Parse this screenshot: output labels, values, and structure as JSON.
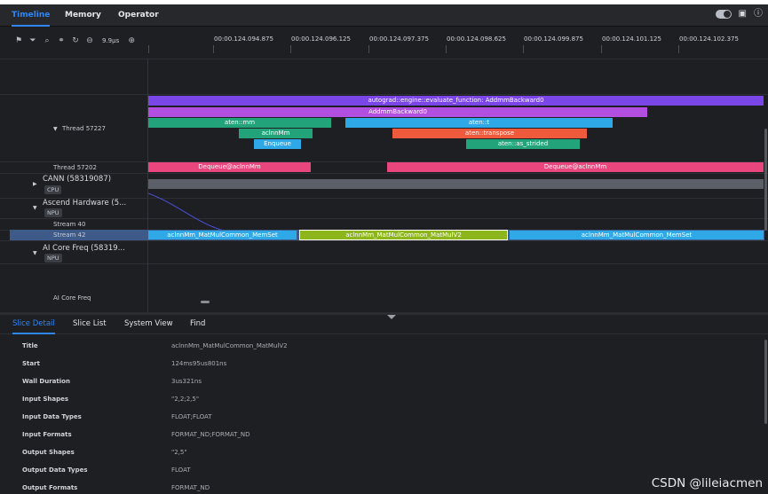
{
  "header": {
    "tabs": [
      {
        "label": "Timeline",
        "active": true
      },
      {
        "label": "Memory",
        "active": false
      },
      {
        "label": "Operator",
        "active": false
      }
    ],
    "icons": [
      "theme-toggle-icon",
      "save-icon",
      "help-icon"
    ]
  },
  "toolbar": {
    "icons": [
      "flag-icon",
      "filter-icon",
      "search-icon",
      "link-icon",
      "reset-icon",
      "zoom-out-icon",
      "zoom-in-icon"
    ],
    "zoom_level": "9.9μs"
  },
  "ruler": {
    "ticks": [
      "00:00.124.094.875",
      "00:00.124.096.125",
      "00:00.124.097.375",
      "00:00.124.098.625",
      "00:00.124.099.875",
      "00:00.124.101.125",
      "00:00.124.102.375"
    ]
  },
  "tracks": {
    "thread1": {
      "label": "Thread 57227"
    },
    "thread2": {
      "label": "Thread 57202"
    },
    "cann": {
      "label": "CANN (58319087)",
      "badge": "CPU"
    },
    "ascend": {
      "label": "Ascend Hardware (5...",
      "badge": "NPU"
    },
    "stream40": {
      "label": "Stream 40"
    },
    "stream42": {
      "label": "Stream 42"
    },
    "aicore": {
      "label": "AI Core Freq (58319...",
      "badge": "NPU"
    },
    "aicore_freq": {
      "label": "AI Core Freq"
    }
  },
  "slices": {
    "evaluate": "autograd::engine::evaluate_function: AddmmBackward0",
    "addmm": "AddmmBackward0",
    "mm": "aten::mm",
    "t": "aten::t",
    "aclnnmm": "aclnnMm",
    "transpose": "aten::transpose",
    "enqueue": "Enqueue",
    "as_strided": "aten::as_strided",
    "dequeue1": "Dequeue@aclnnMm",
    "dequeue2": "Dequeue@aclnnMm",
    "memset1": "aclnnMm_MatMulCommon_MemSet",
    "matmul": "aclnnMm_MatMulCommon_MatMulV2",
    "memset2": "aclnnMm_MatMulCommon_MemSet"
  },
  "colors": {
    "purple": "#7b46e8",
    "violet": "#b24ee0",
    "green": "#22a37a",
    "blue": "#2ea8e6",
    "orange_red": "#f05a3c",
    "pink": "#e8467c",
    "olive": "#8db51c",
    "accent": "#2f86f5"
  },
  "detail_panel": {
    "tabs": [
      {
        "label": "Slice Detail",
        "active": true
      },
      {
        "label": "Slice List",
        "active": false
      },
      {
        "label": "System View",
        "active": false
      },
      {
        "label": "Find",
        "active": false
      }
    ],
    "rows": [
      {
        "key": "Title",
        "value": "aclnnMm_MatMulCommon_MatMulV2"
      },
      {
        "key": "Start",
        "value": "124ms95us801ns"
      },
      {
        "key": "Wall Duration",
        "value": "3us321ns"
      },
      {
        "key": "Input Shapes",
        "value": "\"2,2;2,5\""
      },
      {
        "key": "Input Data Types",
        "value": "FLOAT;FLOAT"
      },
      {
        "key": "Input Formats",
        "value": "FORMAT_ND;FORMAT_ND"
      },
      {
        "key": "Output Shapes",
        "value": "\"2,5\""
      },
      {
        "key": "Output Data Types",
        "value": "FLOAT"
      },
      {
        "key": "Output Formats",
        "value": "FORMAT_ND"
      }
    ]
  },
  "watermark": "CSDN @lileiacmen"
}
